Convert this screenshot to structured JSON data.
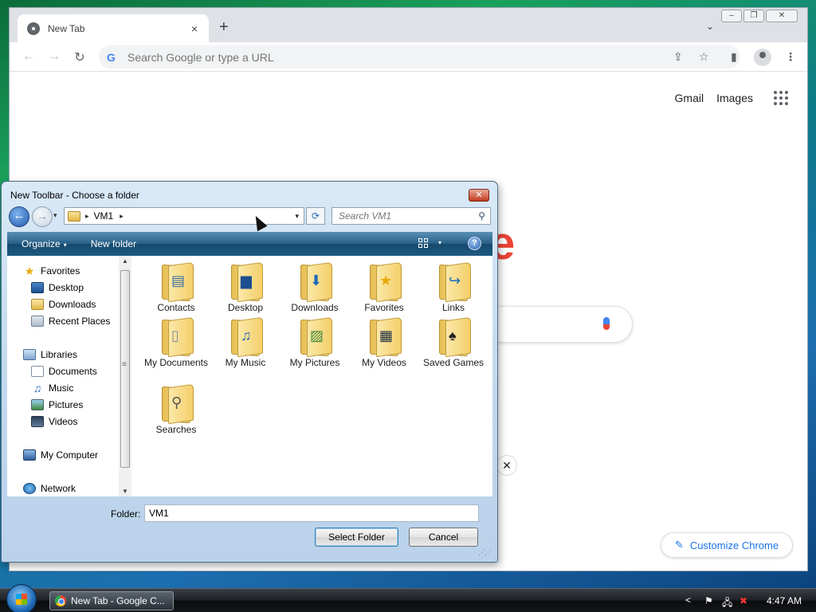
{
  "chrome": {
    "tab_title": "New Tab",
    "tab_close": "×",
    "new_tab": "+",
    "tab_dropdown": "⌄",
    "window_buttons": {
      "minimize": "–",
      "restore": "❐",
      "close": "✕"
    },
    "nav": {
      "back": "←",
      "forward": "→",
      "reload": "↻"
    },
    "omnibox_placeholder": "Search Google or type a URL",
    "omnibox_g": "G",
    "icons": {
      "share": "⇪",
      "bookmark": "☆",
      "side_panel": "▮",
      "menu": "⋮"
    },
    "gmail": "Gmail",
    "images": "Images",
    "logo_fragment": "e",
    "dismiss": "✕",
    "customize_icon": "✎",
    "customize_label": "Customize Chrome"
  },
  "dialog": {
    "title": "New Toolbar - Choose a folder",
    "close": "✕",
    "back": "←",
    "forward": "→",
    "nav_dropdown": "▾",
    "address_sep1": "▸",
    "address_path": "VM1",
    "address_sep2": "▸",
    "address_dropdown": "▾",
    "refresh": "⟳",
    "search_placeholder": "Search VM1",
    "search_icon": "⚲",
    "organize": "Organize",
    "organize_caret": "▾",
    "new_folder": "New folder",
    "views_caret": "▾",
    "help": "?",
    "nav_items": {
      "favorites": "Favorites",
      "desktop": "Desktop",
      "downloads": "Downloads",
      "recent_places": "Recent Places",
      "libraries": "Libraries",
      "documents": "Documents",
      "music": "Music",
      "pictures": "Pictures",
      "videos": "Videos",
      "my_computer": "My Computer",
      "network": "Network"
    },
    "scroll_up": "▲",
    "scroll_down": "▼",
    "folders": {
      "contacts": "Contacts",
      "desktop": "Desktop",
      "downloads": "Downloads",
      "favorites": "Favorites",
      "links": "Links",
      "my_documents": "My Documents",
      "my_music": "My Music",
      "my_pictures": "My Pictures",
      "my_videos": "My Videos",
      "saved_games": "Saved Games",
      "searches": "Searches"
    },
    "folder_label": "Folder:",
    "folder_value": "VM1",
    "select_folder": "Select Folder",
    "cancel": "Cancel",
    "grip": "⋰⋰"
  },
  "taskbar": {
    "task_label": "New Tab - Google C...",
    "tray_arrow": "<",
    "tray_flag": "⚑",
    "tray_network": "🖧",
    "tray_volume": "✖",
    "clock": "4:47 AM"
  }
}
